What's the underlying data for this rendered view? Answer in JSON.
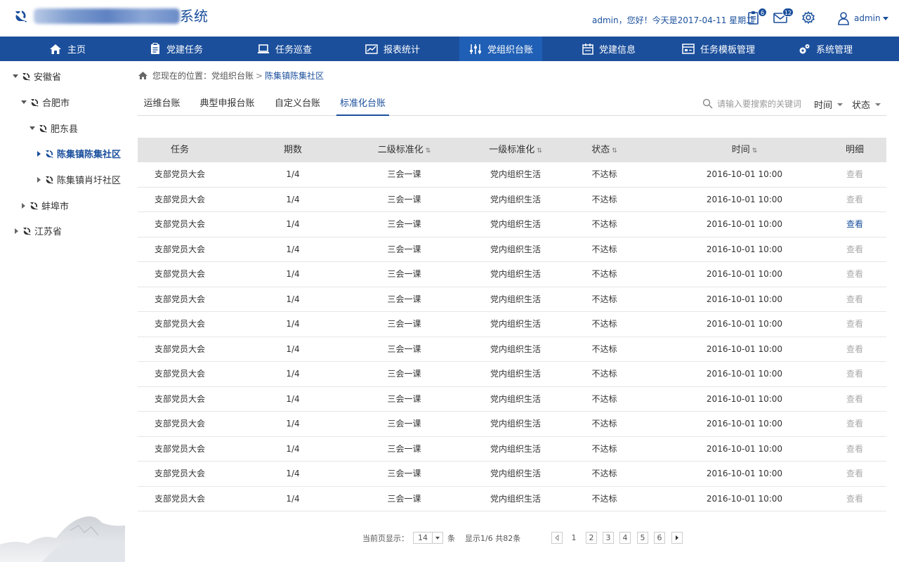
{
  "header": {
    "logo_suffix": "系统",
    "greeting": "admin，您好！今天是2017-04-11  星期二",
    "notice_badge": "6",
    "mail_badge": "12",
    "username": "admin"
  },
  "nav": {
    "items": [
      {
        "label": "主页",
        "icon": "home-icon"
      },
      {
        "label": "党建任务",
        "icon": "clipboard-icon"
      },
      {
        "label": "任务巡查",
        "icon": "laptop-icon"
      },
      {
        "label": "报表统计",
        "icon": "chart-icon"
      },
      {
        "label": "党组织台账",
        "icon": "sliders-icon"
      },
      {
        "label": "党建信息",
        "icon": "calendar-icon"
      },
      {
        "label": "任务模板管理",
        "icon": "template-icon"
      },
      {
        "label": "系统管理",
        "icon": "gears-icon"
      }
    ],
    "active_index": 4
  },
  "sidebar": {
    "tree": [
      {
        "label": "安徽省",
        "level": 0,
        "state": "expanded"
      },
      {
        "label": "合肥市",
        "level": 1,
        "state": "expanded"
      },
      {
        "label": "肥东县",
        "level": 2,
        "state": "expanded"
      },
      {
        "label": "陈集镇陈集社区",
        "level": 3,
        "state": "selected"
      },
      {
        "label": "陈集镇肖圩社区",
        "level": 3,
        "state": "collapsed"
      },
      {
        "label": "蚌埠市",
        "level": 1,
        "state": "collapsed"
      },
      {
        "label": "江苏省",
        "level": 0,
        "state": "collapsed"
      }
    ]
  },
  "breadcrumb": {
    "prefix": "您现在的位置：党组织台账",
    "separator": ">",
    "current": "陈集镇陈集社区"
  },
  "tabs": [
    "运维台账",
    "典型申报台账",
    "自定义台账",
    "标准化台账"
  ],
  "active_tab": 3,
  "search": {
    "placeholder": "请输入要搜索的关键词"
  },
  "filters": {
    "time": "时间",
    "status": "状态"
  },
  "table": {
    "columns": [
      "任务",
      "期数",
      "二级标准化",
      "一级标准化",
      "状态",
      "时间",
      "明细"
    ],
    "sortable": [
      false,
      false,
      true,
      true,
      true,
      true,
      false
    ],
    "sort_glyph": "⇅",
    "rows": [
      [
        "支部党员大会",
        "1/4",
        "三会一课",
        "党内组织生活",
        "不达标",
        "2016-10-01 10:00",
        "查看"
      ],
      [
        "支部党员大会",
        "1/4",
        "三会一课",
        "党内组织生活",
        "不达标",
        "2016-10-01 10:00",
        "查看"
      ],
      [
        "支部党员大会",
        "1/4",
        "三会一课",
        "党内组织生活",
        "不达标",
        "2016-10-01 10:00",
        "查看"
      ],
      [
        "支部党员大会",
        "1/4",
        "三会一课",
        "党内组织生活",
        "不达标",
        "2016-10-01 10:00",
        "查看"
      ],
      [
        "支部党员大会",
        "1/4",
        "三会一课",
        "党内组织生活",
        "不达标",
        "2016-10-01 10:00",
        "查看"
      ],
      [
        "支部党员大会",
        "1/4",
        "三会一课",
        "党内组织生活",
        "不达标",
        "2016-10-01 10:00",
        "查看"
      ],
      [
        "支部党员大会",
        "1/4",
        "三会一课",
        "党内组织生活",
        "不达标",
        "2016-10-01 10:00",
        "查看"
      ],
      [
        "支部党员大会",
        "1/4",
        "三会一课",
        "党内组织生活",
        "不达标",
        "2016-10-01 10:00",
        "查看"
      ],
      [
        "支部党员大会",
        "1/4",
        "三会一课",
        "党内组织生活",
        "不达标",
        "2016-10-01 10:00",
        "查看"
      ],
      [
        "支部党员大会",
        "1/4",
        "三会一课",
        "党内组织生活",
        "不达标",
        "2016-10-01 10:00",
        "查看"
      ],
      [
        "支部党员大会",
        "1/4",
        "三会一课",
        "党内组织生活",
        "不达标",
        "2016-10-01 10:00",
        "查看"
      ],
      [
        "支部党员大会",
        "1/4",
        "三会一课",
        "党内组织生活",
        "不达标",
        "2016-10-01 10:00",
        "查看"
      ],
      [
        "支部党员大会",
        "1/4",
        "三会一课",
        "党内组织生活",
        "不达标",
        "2016-10-01 10:00",
        "查看"
      ],
      [
        "支部党员大会",
        "1/4",
        "三会一课",
        "党内组织生活",
        "不达标",
        "2016-10-01 10:00",
        "查看"
      ]
    ],
    "highlighted_row": 2
  },
  "pagination": {
    "per_page_label": "当前页显示：",
    "per_page_value": "14",
    "unit": "条",
    "summary": "显示1/6  共82条",
    "pages": [
      "1",
      "2",
      "3",
      "4",
      "5",
      "6"
    ],
    "current_page": "1"
  },
  "colors": {
    "primary": "#1b4f9c",
    "nav_active": "#1f5fb5",
    "header_row": "#e3e3e3"
  }
}
